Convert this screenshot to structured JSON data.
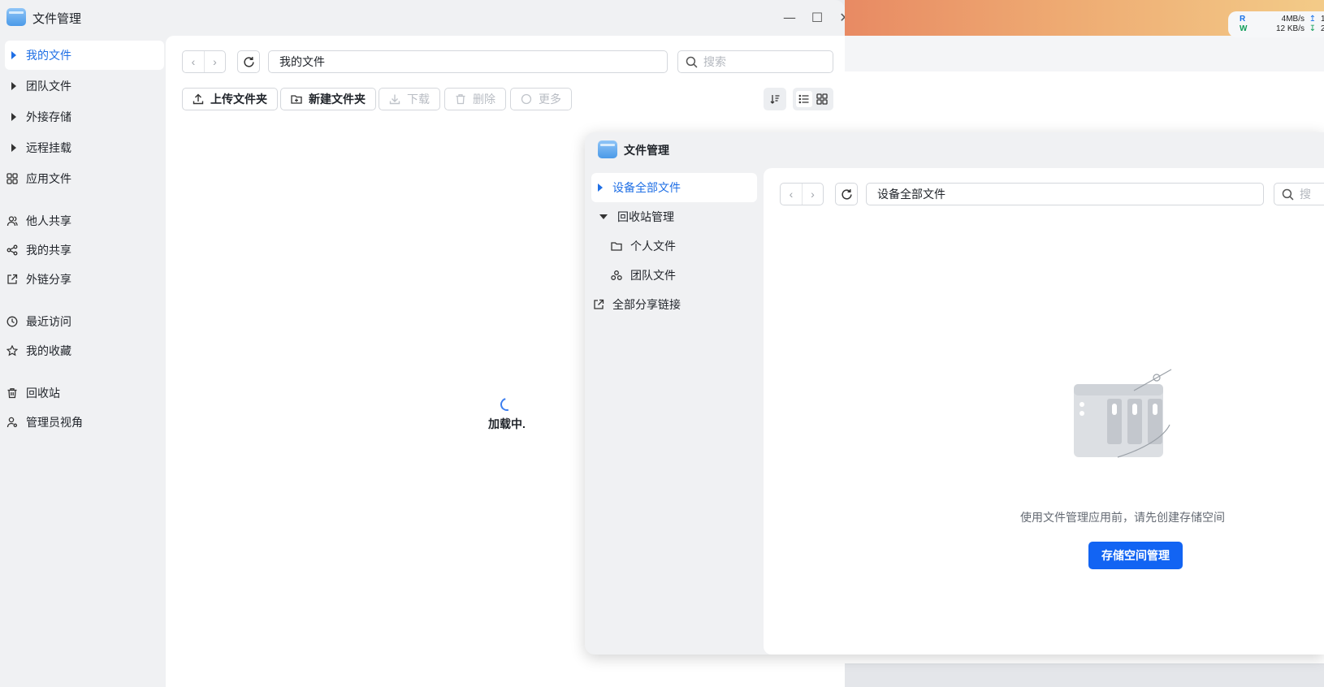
{
  "desktop": {
    "net_widget": {
      "read_label": "R",
      "read_value": "4MB/s",
      "read_extra": "1",
      "write_label": "W",
      "write_value": "12 KB/s",
      "write_extra": "2"
    }
  },
  "window_main": {
    "title": "文件管理",
    "sidebar": {
      "items": [
        {
          "label": "我的文件"
        },
        {
          "label": "团队文件"
        },
        {
          "label": "外接存储"
        },
        {
          "label": "远程挂载"
        },
        {
          "label": "应用文件"
        },
        {
          "label": "他人共享"
        },
        {
          "label": "我的共享"
        },
        {
          "label": "外链分享"
        },
        {
          "label": "最近访问"
        },
        {
          "label": "我的收藏"
        },
        {
          "label": "回收站"
        },
        {
          "label": "管理员视角"
        }
      ]
    },
    "path": "我的文件",
    "search_placeholder": "搜索",
    "toolbar": {
      "upload_label": "上传文件夹",
      "new_folder_label": "新建文件夹",
      "download_label": "下载",
      "delete_label": "删除",
      "more_label": "更多"
    },
    "loading_text": "加载中."
  },
  "window_admin": {
    "title": "文件管理",
    "sidebar": {
      "all_files": "设备全部文件",
      "recycle": "回收站管理",
      "personal_files": "个人文件",
      "team_files": "团队文件",
      "share_links": "全部分享链接"
    },
    "path": "设备全部文件",
    "search_placeholder": "搜",
    "empty_message": "使用文件管理应用前，请先创建存储空间",
    "storage_button": "存储空间管理"
  },
  "colors": {
    "accent": "#1f6fe5",
    "primary_button": "#1264f3"
  }
}
